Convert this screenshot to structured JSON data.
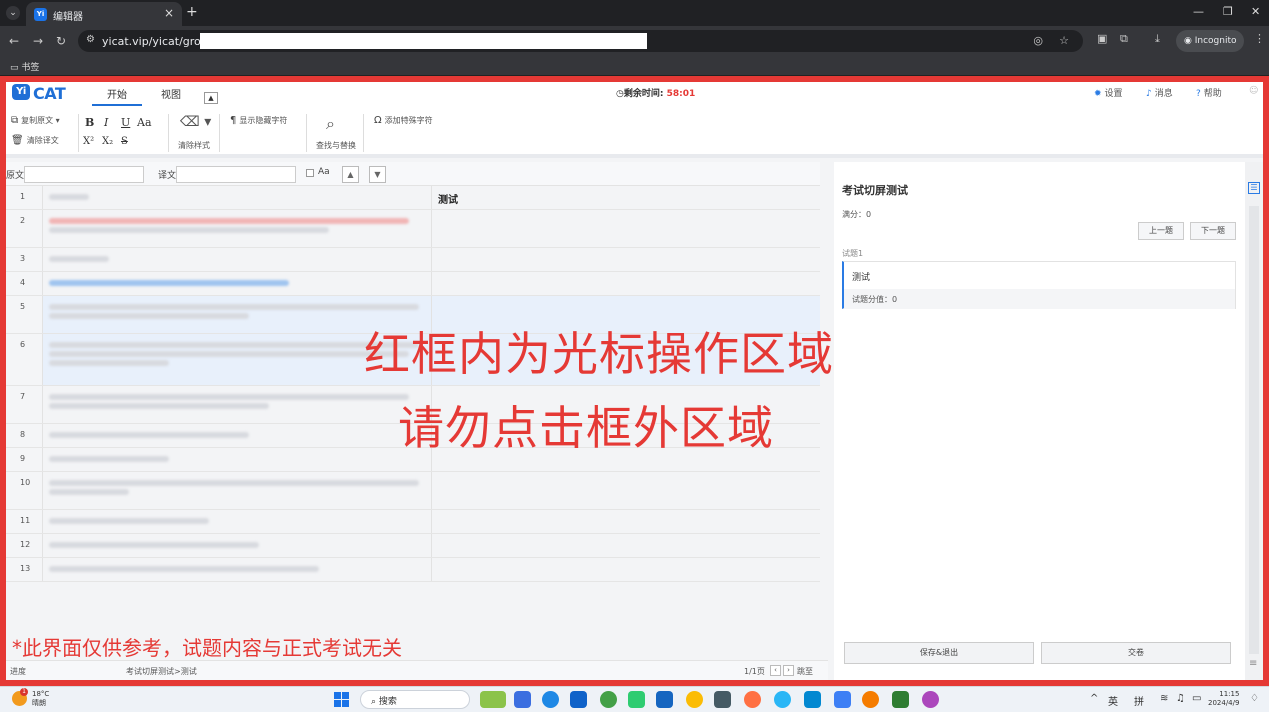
{
  "browser": {
    "tab_title": "编辑器",
    "tab_icon": "Yi",
    "url": "yicat.vip/yicat/group/",
    "incognito_label": "Incognito",
    "bookmarks_label": "书签"
  },
  "app": {
    "logo_badge": "Yi",
    "logo_text": "CAT",
    "tabs": [
      {
        "label": "开始"
      },
      {
        "label": "视图"
      }
    ],
    "timer_label": "剩余时间:",
    "timer_value": "58:01",
    "top_links": {
      "settings": "设置",
      "messages": "消息",
      "help": "帮助"
    },
    "ribbon": {
      "copy_source": "复制原文",
      "clear_target": "清除译文",
      "bold": "B",
      "italic": "I",
      "underline": "U",
      "case": "Aa",
      "superscript": "X²",
      "subscript": "X₂",
      "strike": "S",
      "clear_format": "清除样式",
      "show_hidden": "显示隐藏字符",
      "find_replace": "查找与替换",
      "add_special": "添加特殊字符"
    },
    "filter": {
      "source_label": "原文",
      "target_label": "译文",
      "case_label": "Aa"
    },
    "rows": [
      {
        "num": "1",
        "target": "测试"
      },
      {
        "num": "2",
        "target": ""
      },
      {
        "num": "3",
        "target": ""
      },
      {
        "num": "4",
        "target": ""
      },
      {
        "num": "5",
        "target": ""
      },
      {
        "num": "6",
        "target": ""
      },
      {
        "num": "7",
        "target": ""
      },
      {
        "num": "8",
        "target": ""
      },
      {
        "num": "9",
        "target": ""
      },
      {
        "num": "10",
        "target": ""
      },
      {
        "num": "11",
        "target": ""
      },
      {
        "num": "12",
        "target": ""
      },
      {
        "num": "13",
        "target": ""
      }
    ],
    "overlay": {
      "line1": "红框内为光标操作区域",
      "line2": "请勿点击框外区域",
      "note": "*此界面仅供参考，试题内容与正式考试无关"
    },
    "status": {
      "progress": "进度",
      "path": "考试切屏测试>测试",
      "page": "1/1页",
      "jump": "跳至"
    },
    "panel": {
      "title": "考试切屏测试",
      "score": "满分：0",
      "prev": "上一题",
      "next": "下一题",
      "question_label": "试题1",
      "question": "测试",
      "question_score": "试题分值：0",
      "save_exit": "保存&退出",
      "submit": "交卷"
    }
  },
  "taskbar": {
    "weather_temp": "18°C",
    "weather_desc": "晴朗",
    "weather_badge": "1",
    "search": "搜索",
    "ime1": "英",
    "ime2": "拼",
    "time": "11:15",
    "date": "2024/4/9"
  },
  "colors": {
    "frame": "#e53935",
    "accent": "#1f6fd6",
    "timer": "#e53935"
  }
}
